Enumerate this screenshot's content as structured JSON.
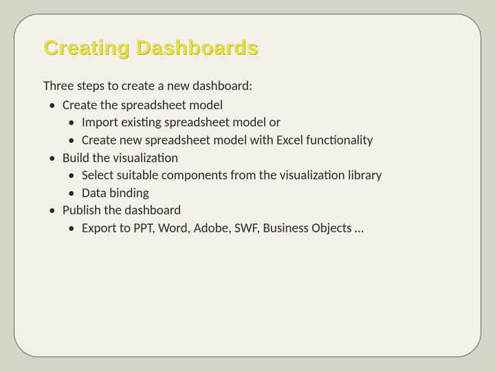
{
  "title": "Creating Dashboards",
  "intro": "Three steps to create a new dashboard:",
  "steps": [
    {
      "label": "Create the spreadsheet model",
      "sub": [
        "Import existing spreadsheet model or",
        "Create new spreadsheet model with Excel functionality"
      ]
    },
    {
      "label": "Build the visualization",
      "sub": [
        "Select suitable components from the visualization library",
        "Data binding"
      ]
    },
    {
      "label": "Publish the dashboard",
      "sub": [
        "Export to PPT, Word, Adobe, SWF, Business Objects …"
      ]
    }
  ]
}
